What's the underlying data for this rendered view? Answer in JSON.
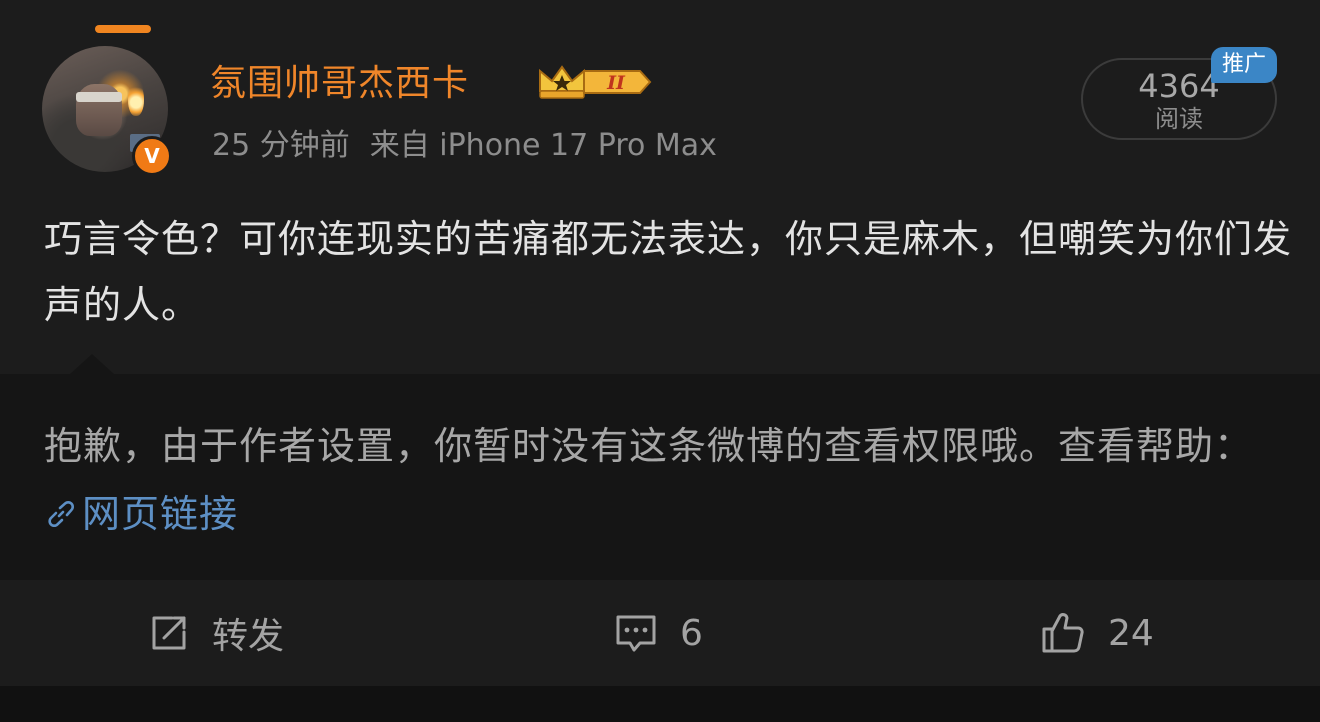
{
  "post": {
    "username": "氛围帅哥杰西卡",
    "level_badge": "II",
    "time": "25 分钟前",
    "source": "来自 iPhone 17 Pro Max",
    "reads_count": "4364",
    "reads_label": "阅读",
    "promo_tag": "推广",
    "verified_badge": "V",
    "text": "巧言令色？可你连现实的苦痛都无法表达，你只是麻木，但嘲笑为你们发声的人。"
  },
  "notice": {
    "text": "抱歉，由于作者设置，你暂时没有这条微博的查看权限哦。查看帮助：",
    "link_label": "网页链接"
  },
  "actions": {
    "repost_label": "转发",
    "comment_count": "6",
    "like_count": "24"
  },
  "icons": {
    "repost": "share-box-icon",
    "comment": "comment-bubble-icon",
    "like": "thumbs-up-icon",
    "link": "link-icon",
    "badge": "crown-icon"
  },
  "colors": {
    "username": "#f0862a",
    "verified": "#f07a15",
    "link": "#5d8fc4",
    "promo": "#3b86c6"
  }
}
